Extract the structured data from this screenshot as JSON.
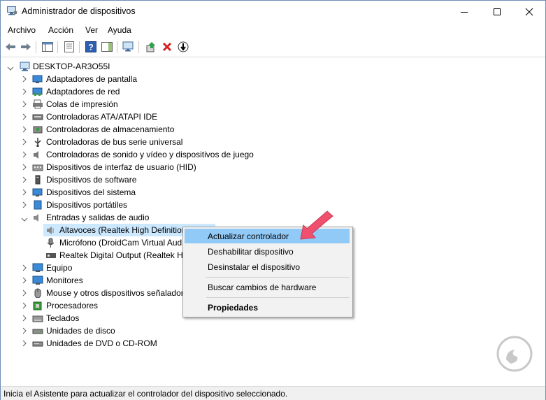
{
  "window": {
    "title": "Administrador de dispositivos"
  },
  "menu": [
    "Archivo",
    "Acción",
    "Ver",
    "Ayuda"
  ],
  "tree": {
    "root": "DESKTOP-AR3O55I",
    "categories": [
      {
        "label": "Adaptadores de pantalla",
        "icon": "display-adapter-icon"
      },
      {
        "label": "Adaptadores de red",
        "icon": "network-adapter-icon"
      },
      {
        "label": "Colas de impresión",
        "icon": "printer-queue-icon"
      },
      {
        "label": "Controladoras ATA/ATAPI IDE",
        "icon": "ide-controller-icon"
      },
      {
        "label": "Controladoras de almacenamiento",
        "icon": "storage-controller-icon"
      },
      {
        "label": "Controladoras de bus serie universal",
        "icon": "usb-controller-icon"
      },
      {
        "label": "Controladoras de sonido y vídeo y dispositivos de juego",
        "icon": "sound-video-icon"
      },
      {
        "label": "Dispositivos de interfaz de usuario (HID)",
        "icon": "hid-icon"
      },
      {
        "label": "Dispositivos de software",
        "icon": "software-device-icon"
      },
      {
        "label": "Dispositivos del sistema",
        "icon": "system-device-icon"
      },
      {
        "label": "Dispositivos portátiles",
        "icon": "portable-device-icon"
      },
      {
        "label": "Entradas y salidas de audio",
        "icon": "audio-io-icon"
      }
    ],
    "audio_children": [
      {
        "label": "Altavoces (Realtek High Definition",
        "icon": "speaker-icon"
      },
      {
        "label": "Micrófono (DroidCam Virtual Aud",
        "icon": "microphone-icon"
      },
      {
        "label": "Realtek Digital Output (Realtek Hi",
        "icon": "digital-output-icon"
      }
    ],
    "categories_after": [
      {
        "label": "Equipo",
        "icon": "computer-icon"
      },
      {
        "label": "Monitores",
        "icon": "monitor-icon"
      },
      {
        "label": "Mouse y otros dispositivos señaladores",
        "icon": "mouse-icon"
      },
      {
        "label": "Procesadores",
        "icon": "processor-icon"
      },
      {
        "label": "Teclados",
        "icon": "keyboard-icon"
      },
      {
        "label": "Unidades de disco",
        "icon": "disk-drive-icon"
      },
      {
        "label": "Unidades de DVD o CD-ROM",
        "icon": "dvd-drive-icon"
      }
    ]
  },
  "context_menu": {
    "update": "Actualizar controlador",
    "disable": "Deshabilitar dispositivo",
    "uninstall": "Desinstalar el dispositivo",
    "scan": "Buscar cambios de hardware",
    "properties": "Propiedades"
  },
  "status": "Inicia el Asistente para actualizar el controlador del dispositivo seleccionado.",
  "colors": {
    "selection": "#cce8ff",
    "menu_highlight": "#91c9f7",
    "annotation_arrow": "#f0506e"
  }
}
